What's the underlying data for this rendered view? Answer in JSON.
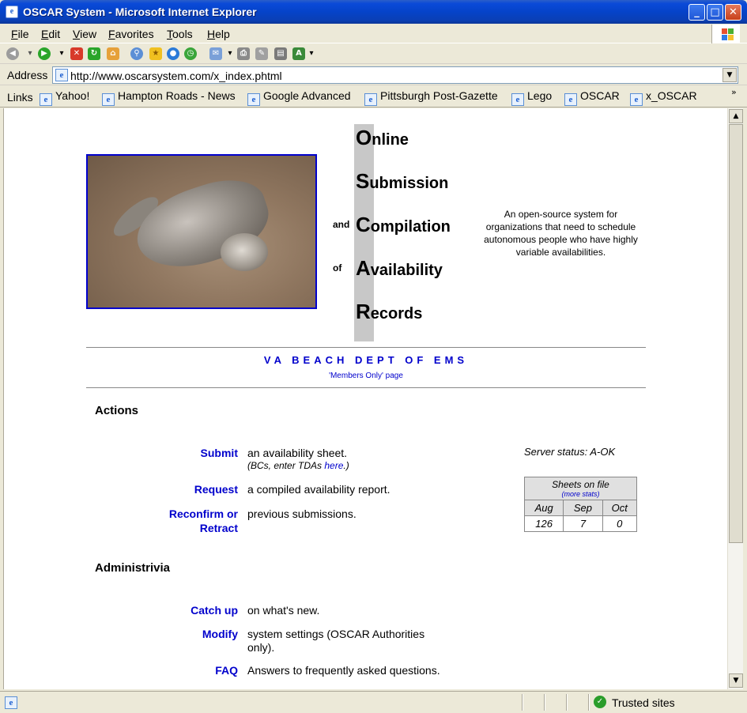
{
  "window": {
    "title": "OSCAR System - Microsoft Internet Explorer",
    "buttons": {
      "minimize": "_",
      "maximize": "□",
      "close": "✕"
    }
  },
  "menu": [
    "File",
    "Edit",
    "View",
    "Favorites",
    "Tools",
    "Help"
  ],
  "address": {
    "label": "Address",
    "url": "http://www.oscarsystem.com/x_index.phtml"
  },
  "links_bar": {
    "label": "Links",
    "items": [
      "Yahoo!",
      "Hampton Roads - News",
      "Google Advanced",
      "Pittsburgh Post-Gazette",
      "Lego",
      "OSCAR",
      "x_OSCAR"
    ],
    "more": "»"
  },
  "acronym": {
    "rows": [
      {
        "letter": "O",
        "rest": "nline",
        "prefix": ""
      },
      {
        "letter": "S",
        "rest": "ubmission",
        "prefix": ""
      },
      {
        "letter": "C",
        "rest": "ompilation",
        "prefix": "and"
      },
      {
        "letter": "A",
        "rest": "vailability",
        "prefix": "of"
      },
      {
        "letter": "R",
        "rest": "ecords",
        "prefix": ""
      }
    ]
  },
  "tagline": "An open-source system for organizations that need to schedule autonomous people who have highly variable availabilities.",
  "dept": {
    "title": "VA BEACH DEPT OF EMS",
    "members_link": "'Members Only' page"
  },
  "actions": {
    "heading": "Actions",
    "items": [
      {
        "link": "Submit",
        "desc": "an availability sheet.",
        "note_before": "(BCs, enter TDAs ",
        "note_link": "here",
        "note_after": ".)"
      },
      {
        "link": "Request",
        "desc": "a compiled availability report."
      },
      {
        "link_line1": "Reconfirm or",
        "link_line2": "Retract",
        "desc": "previous submissions."
      }
    ]
  },
  "administrivia": {
    "heading": "Administrivia",
    "items": [
      {
        "link": "Catch up",
        "desc": "on what's new."
      },
      {
        "link": "Modify",
        "desc_line1": "system settings (OSCAR Authorities",
        "desc_line2": "only)."
      },
      {
        "link": "FAQ",
        "desc": "Answers to frequently asked questions."
      }
    ]
  },
  "server_status": "Server status: A-OK",
  "sheets": {
    "title": "Sheets on file",
    "more_link": "(more stats)",
    "months": [
      "Aug",
      "Sep",
      "Oct"
    ],
    "counts": [
      "126",
      "7",
      "0"
    ]
  },
  "status_bar": {
    "zone": "Trusted sites"
  },
  "colors": {
    "link": "#0000cc",
    "titlebar": "#0a4ad8",
    "acronym_bar": "#c8c8c8"
  }
}
